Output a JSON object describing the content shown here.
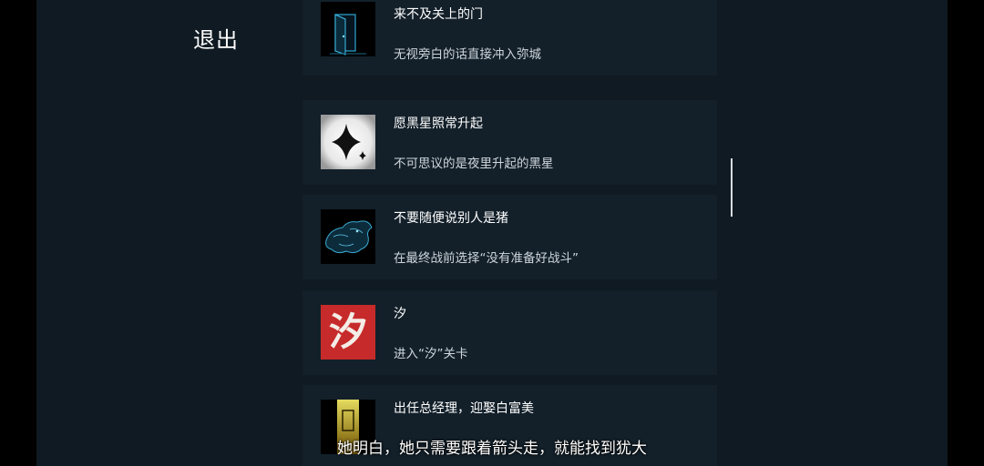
{
  "header": {
    "exit_label": "退出"
  },
  "achievements": [
    {
      "title": "来不及关上的门",
      "description": "无视旁白的话直接冲入弥城",
      "icon": "door-icon"
    },
    {
      "title": "愿黑星照常升起",
      "description": "不可思议的是夜里升起的黑星",
      "icon": "black-star-icon"
    },
    {
      "title": "不要随便说别人是猪",
      "description": "在最终战前选择“没有准备好战斗”",
      "icon": "pig-icon"
    },
    {
      "title": "汐",
      "description": "进入“汐”关卡",
      "icon": "xi-character-icon",
      "icon_text": "汐"
    },
    {
      "title": "出任总经理，迎娶白富美",
      "description": "",
      "icon": "golden-door-icon"
    }
  ],
  "subtitle": "她明白，她只需要跟着箭头走，就能找到犹大",
  "colors": {
    "panel_bg": "#0f1a22",
    "card_bg": "#13202a",
    "xi_red": "#c72a2a",
    "door_blue": "#2fa6d0",
    "gold": "#e0c020"
  }
}
